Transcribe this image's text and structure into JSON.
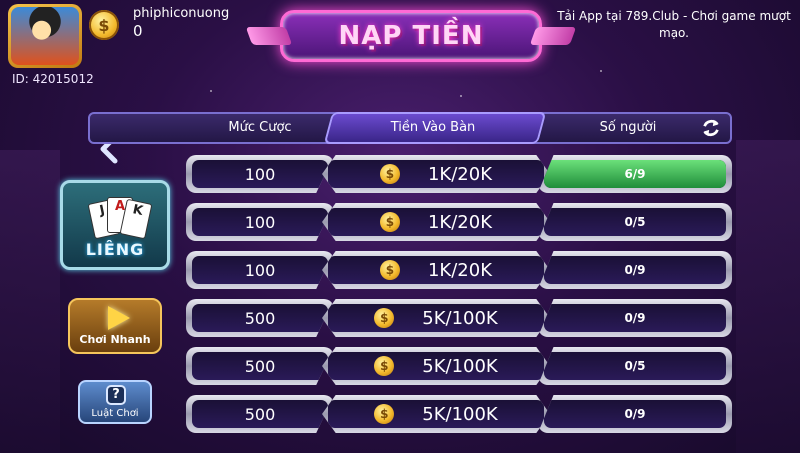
{
  "profile": {
    "username": "phiphiconuong",
    "balance": "0",
    "player_id": "ID: 42015012",
    "coin_symbol": "$"
  },
  "title": "NẠP TIỀN",
  "marquee": "Tải App tại 789.Club - Chơi game mượt mạo.",
  "table_header": {
    "bet_label": "Mức Cược",
    "buyin_label": "Tiền Vào Bàn",
    "players_label": "Số người"
  },
  "game": {
    "name": "LIÊNG",
    "cards": [
      "J",
      "A",
      "K"
    ]
  },
  "buttons": {
    "quick_play": "Chơi Nhanh",
    "rules": "Luật Chơi",
    "rules_icon": "?"
  },
  "rows": [
    {
      "bet": "100",
      "buyin": "1K/20K",
      "players": "6/9",
      "fill": 1.0
    },
    {
      "bet": "100",
      "buyin": "1K/20K",
      "players": "0/5",
      "fill": 0
    },
    {
      "bet": "100",
      "buyin": "1K/20K",
      "players": "0/9",
      "fill": 0
    },
    {
      "bet": "500",
      "buyin": "5K/100K",
      "players": "0/9",
      "fill": 0
    },
    {
      "bet": "500",
      "buyin": "5K/100K",
      "players": "0/5",
      "fill": 0
    },
    {
      "bet": "500",
      "buyin": "5K/100K",
      "players": "0/9",
      "fill": 0
    }
  ],
  "colors": {
    "accent": "#ff4fd8",
    "players_fill": "#2fa84a"
  },
  "icons": [
    "coin-icon",
    "refresh-icon",
    "back-arrow-icon",
    "play-icon",
    "question-icon"
  ]
}
